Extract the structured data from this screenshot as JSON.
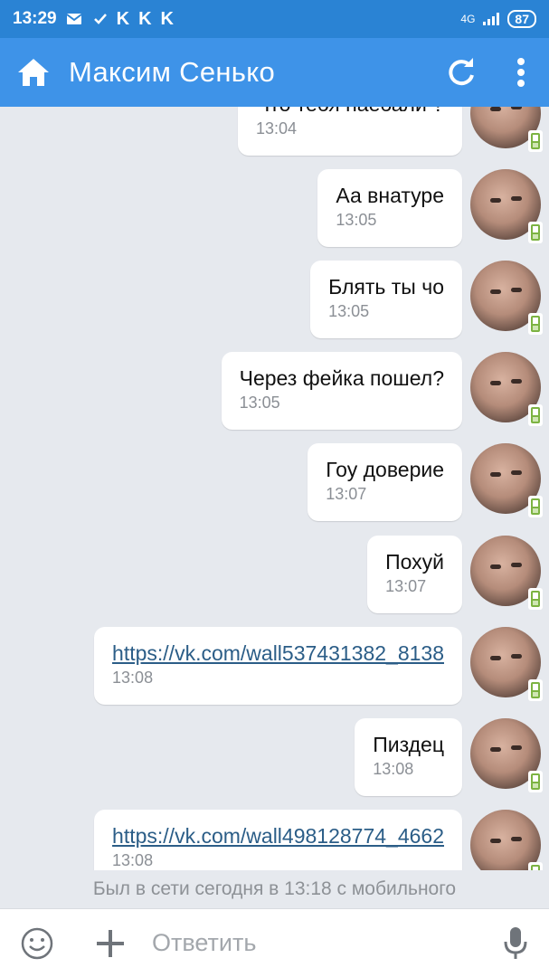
{
  "status_bar": {
    "time": "13:29",
    "notif_letters": [
      "K",
      "K",
      "K"
    ],
    "network": "4G",
    "battery": "87"
  },
  "header": {
    "title": "Максим Сенько",
    "icons": [
      "home-icon",
      "refresh-icon",
      "more-vertical-icon"
    ]
  },
  "messages": [
    {
      "text": "Что тебя наебали ?",
      "time": "13:04",
      "link": false
    },
    {
      "text": "Аа внатуре",
      "time": "13:05",
      "link": false
    },
    {
      "text": "Блять ты чо",
      "time": "13:05",
      "link": false
    },
    {
      "text": "Через фейка пошел?",
      "time": "13:05",
      "link": false
    },
    {
      "text": "Гоу доверие",
      "time": "13:07",
      "link": false
    },
    {
      "text": "Похуй",
      "time": "13:07",
      "link": false
    },
    {
      "text": "https://vk.com/wall537431382_8138",
      "time": "13:08",
      "link": true
    },
    {
      "text": "Пиздец",
      "time": "13:08",
      "link": false
    },
    {
      "text": "https://vk.com/wall498128774_4662",
      "time": "13:08",
      "link": true
    }
  ],
  "last_seen": "Был в сети сегодня в 13:18 с мобильного",
  "composer": {
    "placeholder": "Ответить",
    "icons": [
      "emoji-icon",
      "add-icon",
      "microphone-icon"
    ]
  },
  "colors": {
    "status_bar": "#2a83d4",
    "app_bar": "#3e93e8",
    "background": "#e6e9ee",
    "link": "#2b5d87",
    "mobile_badge": "#7cb342"
  }
}
